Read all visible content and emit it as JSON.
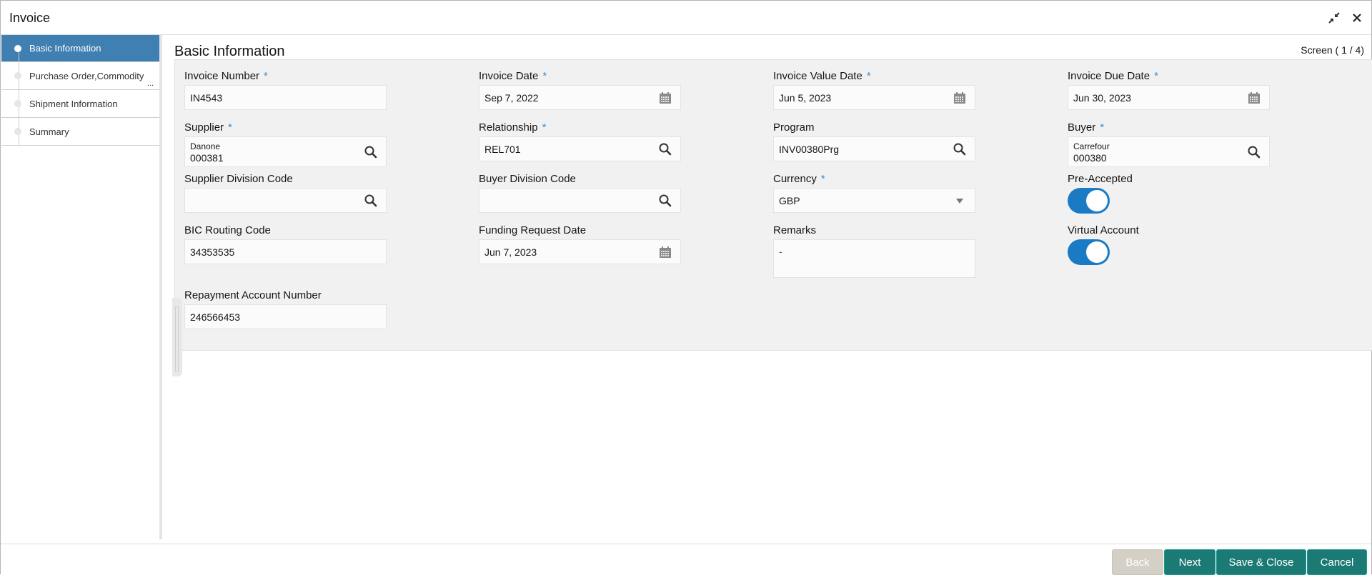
{
  "window": {
    "title": "Invoice",
    "controls": [
      {
        "name": "minimize-restore",
        "icon": "compress-arrows-icon"
      },
      {
        "name": "close",
        "icon": "close-icon"
      }
    ]
  },
  "sidebar": {
    "items": [
      {
        "label": "Basic Information",
        "active": true
      },
      {
        "label": "Purchase Order,Commodity",
        "overflow": "...",
        "active": false
      },
      {
        "label": "Shipment Information",
        "active": false
      },
      {
        "label": "Summary",
        "active": false
      }
    ]
  },
  "main": {
    "section_title": "Basic Information",
    "screen_indicator": "Screen ( 1 / 4)",
    "fields": {
      "invoice_number": {
        "label": "Invoice Number",
        "required": "*",
        "value": "IN4543"
      },
      "invoice_date": {
        "label": "Invoice Date",
        "required": "*",
        "value": "Sep 7, 2022",
        "icon": "calendar-icon"
      },
      "invoice_value_date": {
        "label": "Invoice Value Date",
        "required": "*",
        "value": "Jun 5, 2023",
        "icon": "calendar-icon"
      },
      "invoice_due_date": {
        "label": "Invoice Due Date",
        "required": "*",
        "value": "Jun 30, 2023",
        "icon": "calendar-icon"
      },
      "supplier": {
        "label": "Supplier",
        "required": "*",
        "name": "Danone",
        "value": "000381",
        "icon": "search-icon"
      },
      "relationship": {
        "label": "Relationship",
        "required": "*",
        "value": "REL701",
        "icon": "search-icon"
      },
      "program": {
        "label": "Program",
        "value": "INV00380Prg",
        "icon": "search-icon"
      },
      "buyer": {
        "label": "Buyer",
        "required": "*",
        "name": "Carrefour",
        "value": "000380",
        "icon": "search-icon"
      },
      "supplier_division_code": {
        "label": "Supplier Division Code",
        "value": "",
        "icon": "search-icon"
      },
      "buyer_division_code": {
        "label": "Buyer Division Code",
        "value": "",
        "icon": "search-icon"
      },
      "currency": {
        "label": "Currency",
        "required": "*",
        "value": "GBP",
        "icon": "dropdown-caret-icon"
      },
      "pre_accepted": {
        "label": "Pre-Accepted",
        "on": true
      },
      "bic_routing_code": {
        "label": "BIC Routing Code",
        "value": "34353535"
      },
      "funding_request_date": {
        "label": "Funding Request Date",
        "value": "Jun 7, 2023",
        "icon": "calendar-icon"
      },
      "remarks": {
        "label": "Remarks",
        "value": "-"
      },
      "virtual_account": {
        "label": "Virtual Account",
        "on": true
      },
      "repayment_account_number": {
        "label": "Repayment Account Number",
        "value": "246566453"
      }
    }
  },
  "footer": {
    "back_label": "Back",
    "next_label": "Next",
    "save_close_label": "Save & Close",
    "cancel_label": "Cancel"
  },
  "colors": {
    "accent": "#3f7fb2",
    "toggle_on": "#1a7bc4",
    "primary_button": "#1b7a74",
    "required_asterisk": "#3a8fd1"
  }
}
